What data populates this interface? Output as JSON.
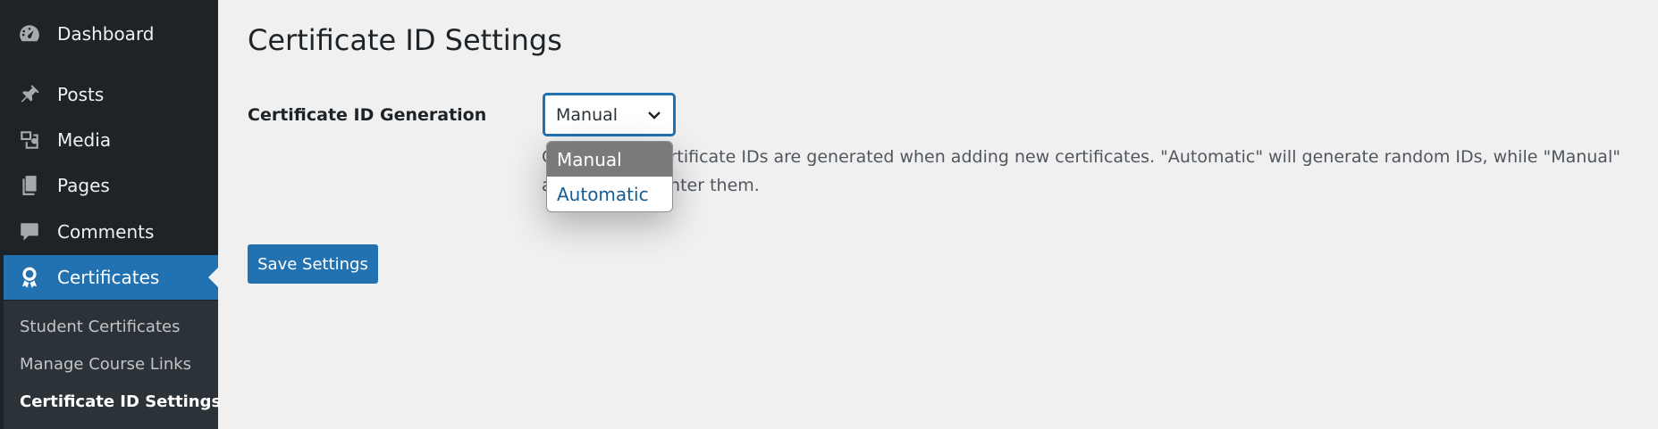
{
  "sidebar": {
    "menu": [
      {
        "label": "Dashboard",
        "icon": "dashboard-icon"
      },
      {
        "label": "Posts",
        "icon": "pushpin-icon"
      },
      {
        "label": "Media",
        "icon": "media-icon"
      },
      {
        "label": "Pages",
        "icon": "pages-icon"
      },
      {
        "label": "Comments",
        "icon": "comment-icon"
      },
      {
        "label": "Certificates",
        "icon": "award-icon",
        "current": true
      }
    ],
    "submenu": [
      {
        "label": "Student Certificates"
      },
      {
        "label": "Manage Course Links"
      },
      {
        "label": "Certificate ID Settings",
        "current": true
      }
    ]
  },
  "main": {
    "title": "Certificate ID Settings",
    "field_label": "Certificate ID Generation",
    "select": {
      "value": "Manual",
      "options": [
        "Manual",
        "Automatic"
      ]
    },
    "description": "Choose how certificate IDs are generated when adding new certificates. \"Automatic\" will generate random IDs, while \"Manual\" allows you to enter them.",
    "save_button": "Save Settings"
  },
  "colors": {
    "sidebar_bg": "#1d2327",
    "accent": "#2271b1",
    "background": "#f0f0f1"
  }
}
